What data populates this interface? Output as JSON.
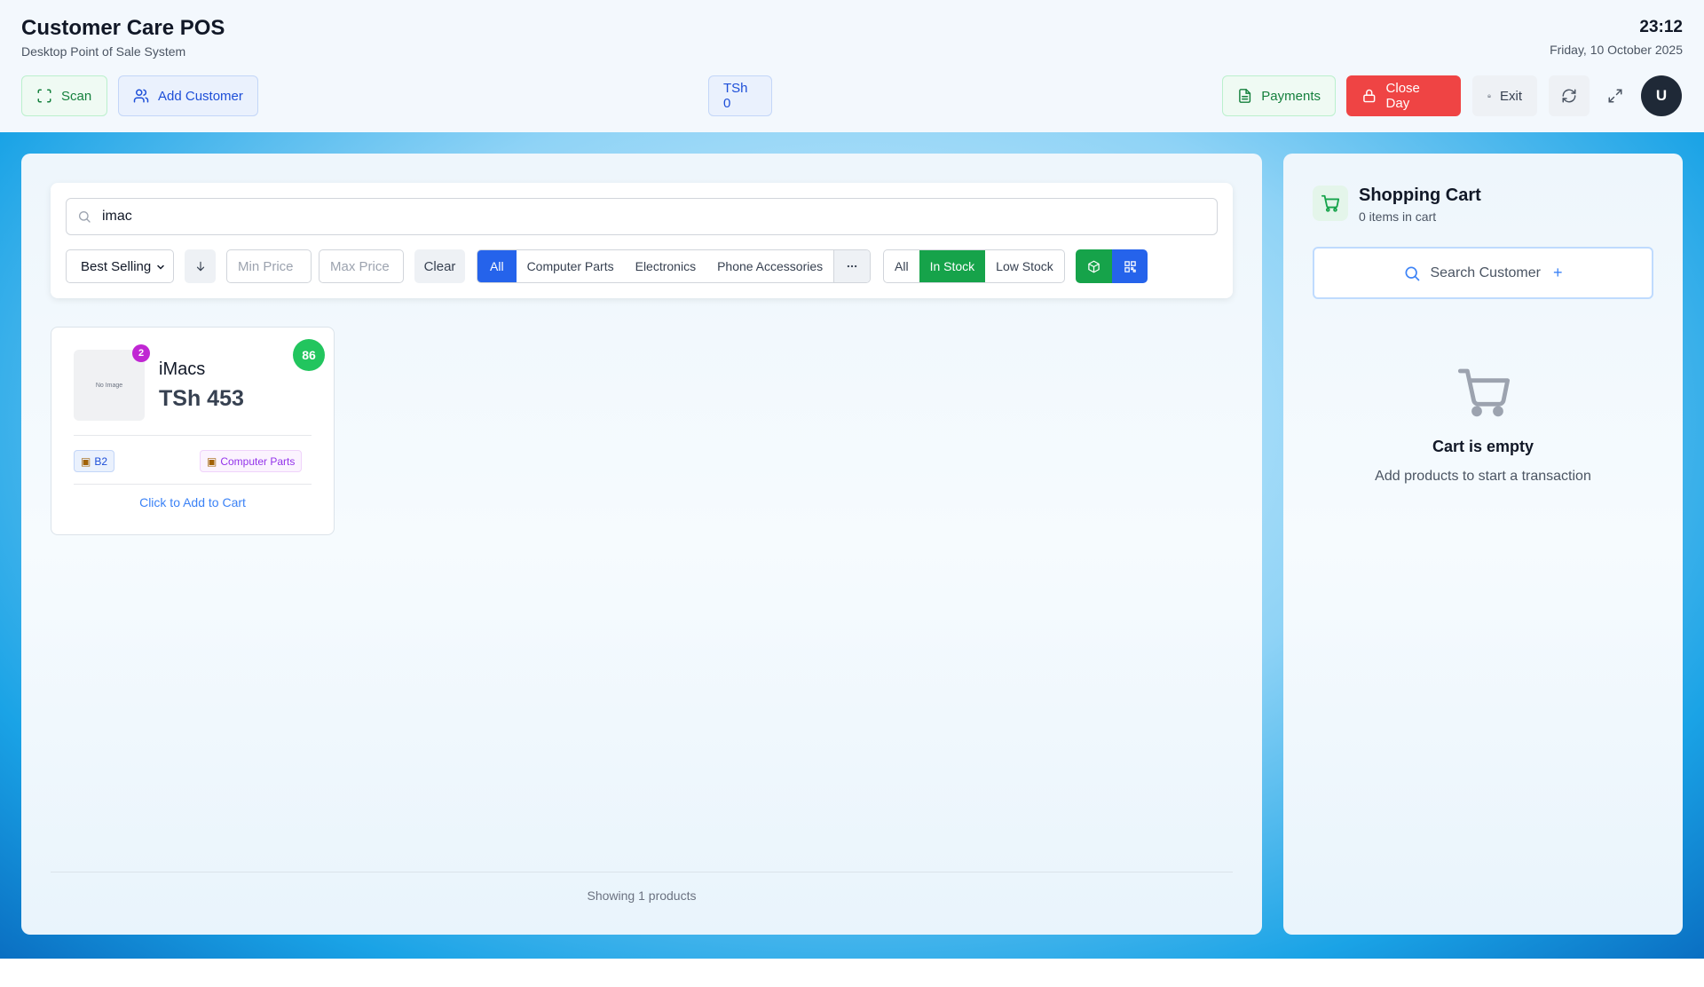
{
  "header": {
    "title": "Customer Care POS",
    "subtitle": "Desktop Point of Sale System",
    "time": "23:12",
    "date": "Friday, 10 October 2025",
    "scan_label": "Scan",
    "add_customer_label": "Add Customer",
    "cart_total": "TSh 0",
    "payments_label": "Payments",
    "close_day_label": "Close Day",
    "exit_label": "Exit",
    "avatar_initial": "U"
  },
  "filters": {
    "search_value": "imac",
    "sort_selected": "Best Selling",
    "min_price_placeholder": "Min Price",
    "max_price_placeholder": "Max Price",
    "clear_label": "Clear",
    "categories": [
      "All",
      "Computer Parts",
      "Electronics",
      "Phone Accessories"
    ],
    "active_category": "All",
    "stock_options": [
      "All",
      "In Stock",
      "Low Stock"
    ],
    "active_stock": "In Stock"
  },
  "products": [
    {
      "name": "iMacs",
      "price": "TSh 453",
      "stock": "86",
      "image_badge": "2",
      "image_placeholder": "No Image",
      "location_tag": "B2",
      "category_tag": "Computer Parts",
      "action_label": "Click to Add to Cart"
    }
  ],
  "footer": {
    "showing": "Showing 1 products"
  },
  "cart": {
    "title": "Shopping Cart",
    "count": "0 items in cart",
    "search_customer": "Search Customer",
    "empty_title": "Cart is empty",
    "empty_subtitle": "Add products to start a transaction"
  },
  "colors": {
    "primary_blue": "#2563eb",
    "success_green": "#16a34a",
    "danger_red": "#ef4444",
    "badge_purple": "#c026d3"
  },
  "icons": {
    "scan": "scan-icon",
    "add_customer": "users-icon",
    "payments": "document-icon",
    "close_day": "lock-icon",
    "exit": "home-icon",
    "refresh": "refresh-icon",
    "expand": "expand-icon",
    "cart": "cart-icon"
  }
}
